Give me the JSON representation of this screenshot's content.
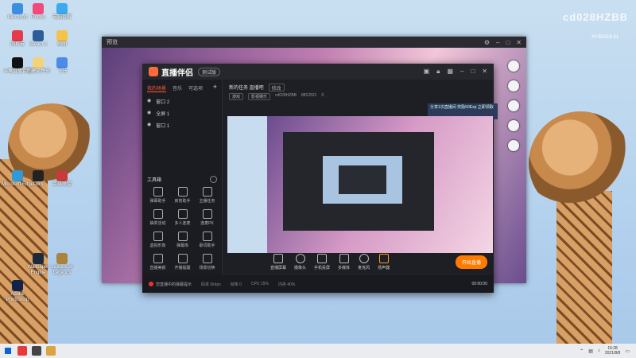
{
  "watermark": {
    "id": "cd028HZBB",
    "line2": "斗鱼",
    "line3": "XY3D018 01"
  },
  "desktop_icons": [
    {
      "label": "Microsoft"
    },
    {
      "label": "iTunes"
    },
    {
      "label": "电脑管家"
    },
    {
      "label": "网易云"
    },
    {
      "label": "Steam 2"
    },
    {
      "label": "画图"
    },
    {
      "label": "斗鱼直播伴侣"
    },
    {
      "label": "新建文件夹"
    },
    {
      "label": "飞书"
    },
    {
      "label": "Microsoft Edge"
    },
    {
      "label": "OBS"
    },
    {
      "label": "英雄联盟"
    },
    {
      "label": "Adobe Photoshop"
    },
    {
      "label": "Wallpaper Engine"
    },
    {
      "label": "League of Legends"
    }
  ],
  "preview_window": {
    "title": "预览"
  },
  "app": {
    "name": "直播伴侣",
    "beta": "测试版",
    "tabs": [
      "我的场景",
      "音乐",
      "可选项"
    ],
    "scenes": [
      "窗口 2",
      "全屏 1",
      "窗口 1"
    ],
    "session_title": "新的任务 直播吧",
    "edit_label": "修改",
    "meta": [
      "游戏",
      "影视娱乐",
      "cd028HZBB",
      "8812521",
      "0"
    ],
    "tools_title": "工具箱",
    "tools": [
      "弹幕助手",
      "房管助手",
      "主播任务",
      "抽奖活动",
      "多人连麦",
      "连麦PK",
      "虚拟形象",
      "弹幕库",
      "歌词助手",
      "直播美颜",
      "开播提醒",
      "场景切换"
    ],
    "notice": "分享1次直播间 奖励50Exp 立即领取",
    "controls": [
      "直播屏幕",
      "摄像头",
      "手机投屏",
      "多媒体",
      "麦克风",
      "扬声器"
    ],
    "go_live": "开始直播",
    "status_text": "您直播中的弹幕提示",
    "status_items": [
      "码率 0kbps",
      "帧率 0",
      "CPU 15%",
      "内存 40%",
      "00:00:00"
    ]
  },
  "taskbar": {
    "time": "15:28",
    "date": "2021/8/8"
  }
}
